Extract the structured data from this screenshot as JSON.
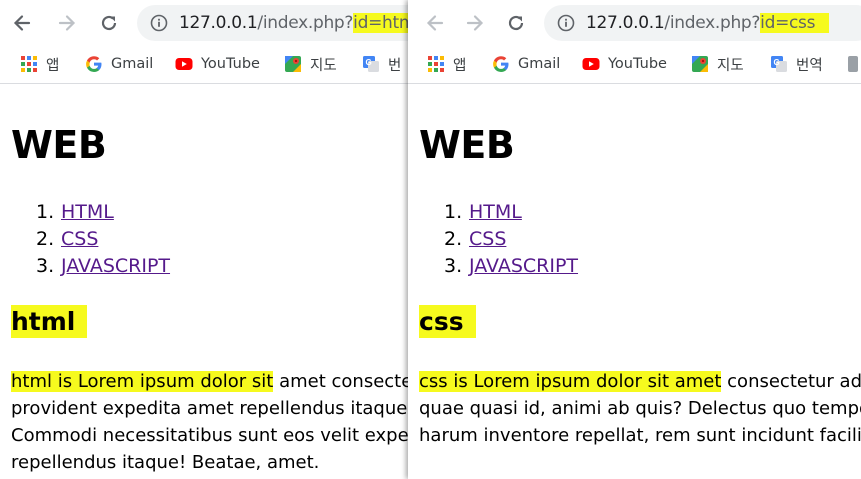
{
  "colors": {
    "highlight": "#f6fa1e",
    "link": "#551a8b",
    "omnibox": "#f1f3f4"
  },
  "left": {
    "url": {
      "host": "127.0.0.1",
      "path": "/index.php?",
      "query": "id=html"
    },
    "bookmarks": [
      {
        "label": "앱",
        "icon": "apps-grid-icon"
      },
      {
        "label": "Gmail",
        "icon": "google-icon"
      },
      {
        "label": "YouTube",
        "icon": "youtube-icon"
      },
      {
        "label": "지도",
        "icon": "maps-icon"
      },
      {
        "label": "번",
        "icon": "translate-icon"
      }
    ],
    "page": {
      "title": "WEB",
      "nav": [
        {
          "num": "1.",
          "label": "HTML"
        },
        {
          "num": "2.",
          "label": "CSS"
        },
        {
          "num": "3.",
          "label": "JAVASCRIPT"
        }
      ],
      "heading": "html",
      "paragraph": {
        "line1_highlight": "html is Lorem ipsum dolor sit",
        "line1_rest": " amet consectetur adipisicing elit.",
        "line2": "provident expedita amet repellendus itaque.",
        "line3": "Commodi necessitatibus sunt eos velit expedita",
        "line4": "repellendus itaque! Beatae, amet."
      }
    }
  },
  "right": {
    "url": {
      "host": "127.0.0.1",
      "path": "/index.php?",
      "query": "id=css"
    },
    "bookmarks": [
      {
        "label": "앱",
        "icon": "apps-grid-icon"
      },
      {
        "label": "Gmail",
        "icon": "google-icon"
      },
      {
        "label": "YouTube",
        "icon": "youtube-icon"
      },
      {
        "label": "지도",
        "icon": "maps-icon"
      },
      {
        "label": "번역",
        "icon": "translate-icon"
      }
    ],
    "page": {
      "title": "WEB",
      "nav": [
        {
          "num": "1.",
          "label": "HTML"
        },
        {
          "num": "2.",
          "label": "CSS"
        },
        {
          "num": "3.",
          "label": "JAVASCRIPT"
        }
      ],
      "heading": "css",
      "paragraph": {
        "line1_highlight": "css is Lorem ipsum dolor sit amet",
        "line1_rest": " consectetur adipisicing",
        "line2": "quae quasi id, animi ab quis? Delectus quo tempora",
        "line3": "harum inventore repellat, rem sunt incidunt facilis"
      }
    }
  }
}
